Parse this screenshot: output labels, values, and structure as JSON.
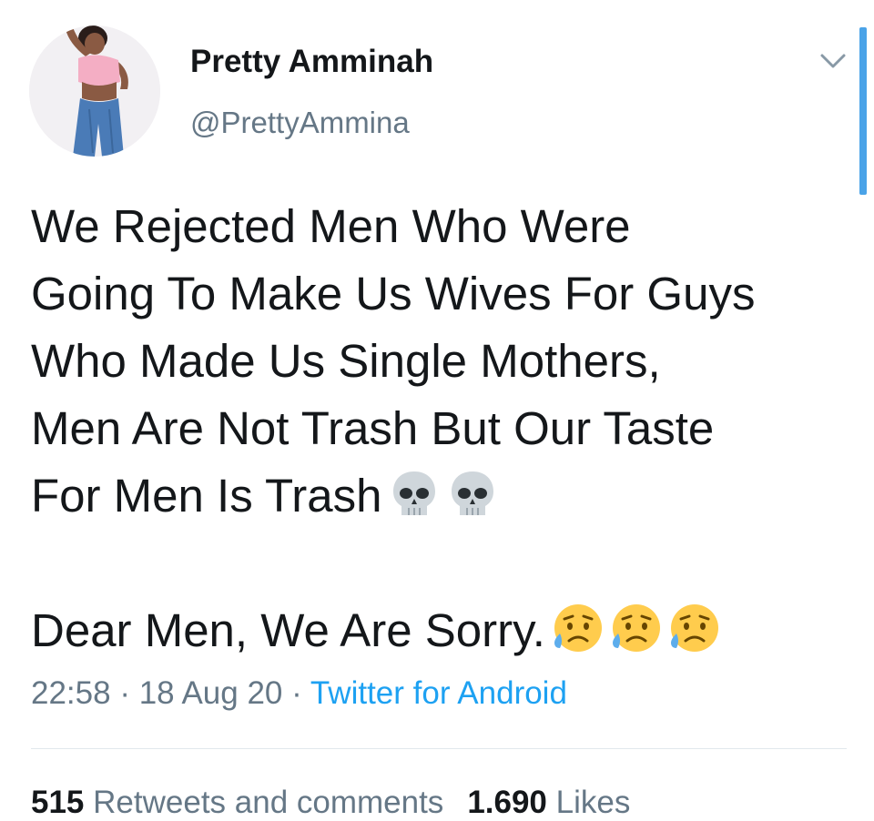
{
  "author": {
    "display_name": "Pretty Amminah",
    "handle": "@PrettyAmmina"
  },
  "tweet": {
    "lines": [
      "We Rejected Men Who Were",
      "Going To Make Us Wives For Guys",
      "Who Made Us Single Mothers,",
      "Men Are Not Trash But Our Taste",
      "For Men Is Trash"
    ],
    "line2": "Dear Men, We Are Sorry.",
    "emoji_first_line": [
      "skull-icon",
      "skull-icon"
    ],
    "emoji_second_line": [
      "sad-relieved-face-icon",
      "sad-relieved-face-icon",
      "sad-relieved-face-icon"
    ]
  },
  "meta": {
    "time": "22:58",
    "separator": "·",
    "date": "18 Aug 20",
    "source": "Twitter for Android"
  },
  "stats": {
    "retweets_count": "515",
    "retweets_label": "Retweets and comments",
    "likes_count": "1.690",
    "likes_label": "Likes"
  },
  "colors": {
    "text": "#14171a",
    "secondary": "#657786",
    "link": "#1da1f2",
    "divider": "#e1e8ed",
    "scrollbar": "#4aa3e8"
  }
}
